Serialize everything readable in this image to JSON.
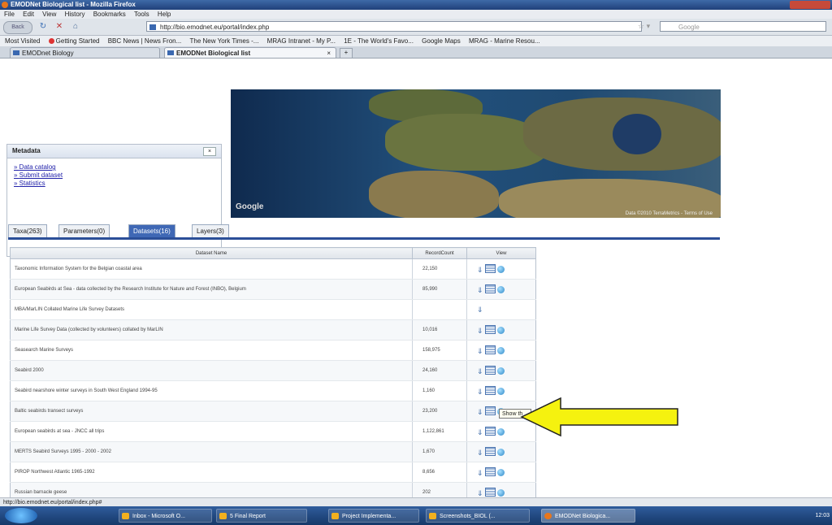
{
  "window": {
    "title": "EMODNet Biological list - Mozilla Firefox"
  },
  "menu": [
    "File",
    "Edit",
    "View",
    "History",
    "Bookmarks",
    "Tools",
    "Help"
  ],
  "nav": {
    "url": "http://bio.emodnet.eu/portal/index.php",
    "search_placeholder": "Google",
    "back_label": "Back"
  },
  "bookmarks": [
    "Most Visited",
    "Getting Started",
    "BBC News | News Fron...",
    "The New York Times -...",
    "MRAG Intranet - My P...",
    "1E - The World's Favo...",
    "Google Maps",
    "MRAG - Marine Resou..."
  ],
  "browser_tabs": [
    {
      "label": "EMODnet Biology"
    },
    {
      "label": "EMODNet Biological list",
      "close": "×"
    }
  ],
  "metadata": {
    "title": "Metadata",
    "close": "×",
    "links": [
      "Data catalog",
      "Submit dataset",
      "Statistics"
    ]
  },
  "map": {
    "google": "Google",
    "copyright": "Data ©2010 TerraMetrics - Terms of Use"
  },
  "page_tabs": [
    "Taxa(263)",
    "Parameters(0)",
    "Datasets(16)",
    "Layers(3)"
  ],
  "grid": {
    "headers": [
      "Dataset Name",
      "RecordCount",
      "View"
    ],
    "rows": [
      {
        "name": "Taxonomic Information System for the Belgian coastal area",
        "count": "22,150",
        "icons": 3
      },
      {
        "name": "European Seabirds at Sea - data collected by the Research Institute for Nature and Forest (INBO), Belgium",
        "count": "85,990",
        "icons": 3
      },
      {
        "name": "MBA/MarLIN Collated Marine Life Survey Datasets",
        "count": "",
        "icons": 1
      },
      {
        "name": "Marine Life Survey Data (collected by volunteers) collated by MarLIN",
        "count": "10,016",
        "icons": 3
      },
      {
        "name": "Seasearch Marine Surveys",
        "count": "158,975",
        "icons": 3
      },
      {
        "name": "Seabird 2000",
        "count": "24,160",
        "icons": 3
      },
      {
        "name": "Seabird nearshore winter surveys in South West England 1994-95",
        "count": "1,160",
        "icons": 3
      },
      {
        "name": "Baltic seabirds transect surveys",
        "count": "23,200",
        "icons": 3
      },
      {
        "name": "European seabirds at sea - JNCC all trips",
        "count": "1,122,861",
        "icons": 3
      },
      {
        "name": "MERTS Seabird Surveys 1995 - 2000 - 2002",
        "count": "1,670",
        "icons": 3
      },
      {
        "name": "PIROP Northwest Atlantic 1965-1992",
        "count": "8,656",
        "icons": 3
      },
      {
        "name": "Russian barnacle geese",
        "count": "202",
        "icons": 3
      }
    ]
  },
  "tooltip": "Show th",
  "status_url": "http://bio.emodnet.eu/portal/index.php#",
  "taskbar": {
    "items": [
      "Inbox - Microsoft O...",
      "5 Final Report",
      "Project Implementa...",
      "Screenshots_BIOL (...",
      "EMODNet Biologica..."
    ],
    "clock": "12:03"
  }
}
